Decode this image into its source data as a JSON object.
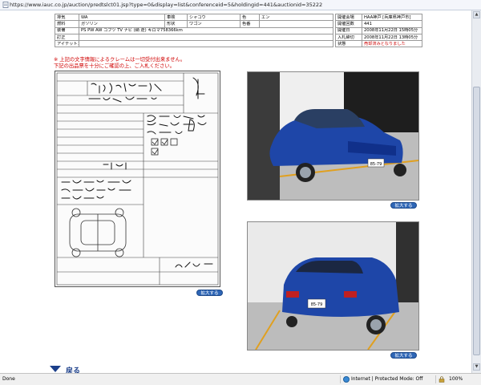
{
  "address_bar": {
    "url": "https://www.iauc.co.jp/auction/predtslct01.jsp?type=0&display=list&conferenceid=5&holdingid=441&auctionid=35222"
  },
  "spec_table": {
    "rows": [
      [
        "排気",
        "WA",
        "車検",
        "シャコウ",
        "色",
        "エン"
      ],
      [
        "燃料",
        "ガソリン",
        "形状",
        "ワゴン",
        "色番",
        ""
      ],
      [
        "装備",
        "PS PW AW コブツ TV ナビ (納 走) キロマ758366km",
        "",
        "",
        "",
        ""
      ],
      [
        "訂正",
        "",
        "",
        "",
        "",
        ""
      ],
      [
        "アイテットコメント",
        "",
        "",
        "",
        "",
        ""
      ]
    ]
  },
  "event_table": {
    "rows": [
      [
        "開催会場",
        "HAA神戸 [兵庫県神戸市]"
      ],
      [
        "開催回数",
        "441"
      ],
      [
        "開催日",
        "2008年11月22日 15時05分"
      ],
      [
        "入札締切",
        "2008年11月22日 13時05分"
      ],
      [
        "状態",
        "売却済みとなりました"
      ]
    ]
  },
  "notices": [
    "※ 上記の文字情報によるクレームは一切受付出来ません。",
    "下記の出品票を十分にご確認の上、ご入札ください。"
  ],
  "auction_sheet": {
    "lot_number": "35222",
    "handwritten": [
      "16 イプサム 5 SW 240u サギルソーンノップ",
      "コラ ACM 2AW",
      "ワンオーナー",
      "13370",
      "4",
      "B"
    ],
    "footer_text": "次历 30/7 8597"
  },
  "buttons": {
    "enlarge_label": "拡大する"
  },
  "footer": {
    "back_label": "戻る"
  },
  "status_bar": {
    "left": "Done",
    "zone": "Internet | Protected Mode: Off",
    "zoom": "100%"
  },
  "photo_plates": [
    "85-79",
    "85-79"
  ],
  "colors": {
    "car_body": "#1e46a8",
    "notice_red": "#d00000",
    "link_blue": "#1b3f8a",
    "button_blue": "#2e66b6"
  },
  "icons": [
    "page-icon",
    "chevron-up-icon",
    "chevron-down-icon",
    "globe-icon",
    "lock-icon",
    "back-arrow-icon"
  ]
}
